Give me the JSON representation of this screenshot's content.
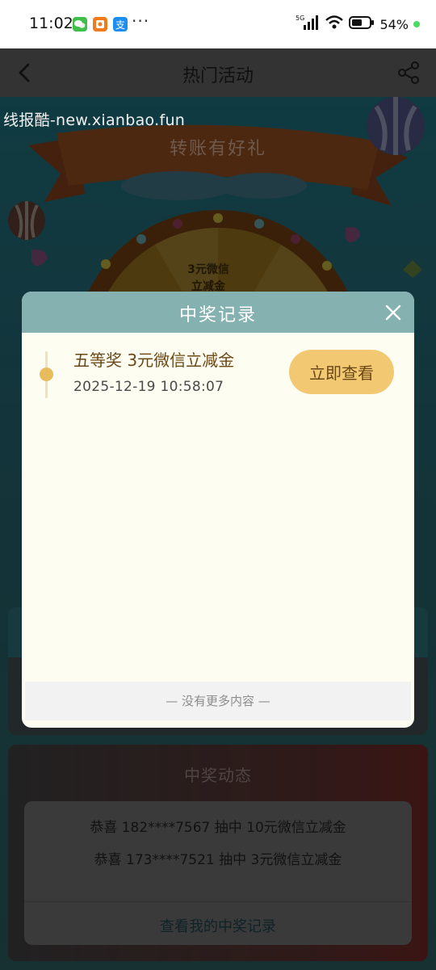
{
  "status_bar": {
    "time": "11:02",
    "network": "5G",
    "battery_percent": "54%",
    "overflow": "···"
  },
  "header": {
    "title": "热门活动"
  },
  "watermark": "线报酷-new.xianbao.fun",
  "background": {
    "banner_title": "转账有好礼",
    "wheel_segment_label": "3元微信立减金",
    "feed": {
      "title": "中奖动态",
      "rows": [
        "恭喜 182****7567 抽中 10元微信立减金",
        "恭喜 173****7521 抽中 3元微信立减金"
      ],
      "link_label": "查看我的中奖记录"
    }
  },
  "modal": {
    "title": "中奖记录",
    "records": [
      {
        "prize": "五等奖 3元微信立减金",
        "time": "2025-12-19 10:58:07",
        "action_label": "立即查看"
      }
    ],
    "footer": "—  没有更多内容  —"
  },
  "colors": {
    "modal_header": "#85b1b0",
    "modal_body": "#fdfdf2",
    "action_button": "#f2c972",
    "prize_text": "#6b4715"
  }
}
